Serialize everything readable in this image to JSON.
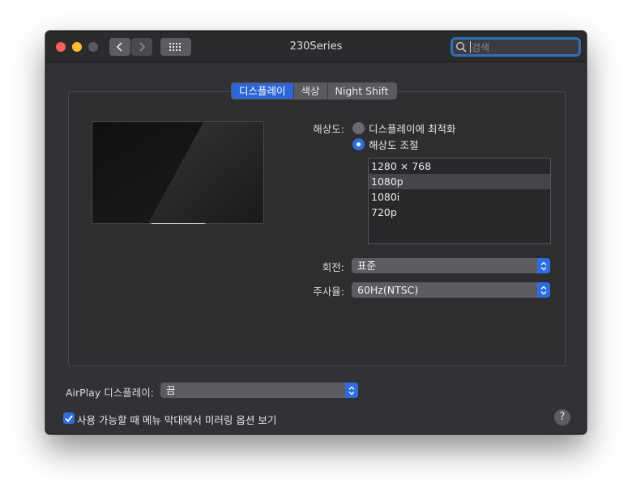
{
  "window": {
    "title": "230Series",
    "search_placeholder": "검색"
  },
  "tabs": [
    {
      "label": "디스플레이",
      "active": true
    },
    {
      "label": "색상",
      "active": false
    },
    {
      "label": "Night Shift",
      "active": false
    }
  ],
  "resolution": {
    "label": "해상도:",
    "options": [
      {
        "label": "디스플레이에 최적화",
        "selected": false
      },
      {
        "label": "해상도 조절",
        "selected": true
      }
    ],
    "list": [
      "1280 × 768",
      "1080p",
      "1080i",
      "720p"
    ],
    "selected_item": "1080p"
  },
  "rotation": {
    "label": "회전:",
    "value": "표준"
  },
  "refresh_rate": {
    "label": "주사율:",
    "value": "60Hz(NTSC)"
  },
  "airplay": {
    "label": "AirPlay 디스플레이:",
    "value": "끔"
  },
  "mirroring_option": {
    "label": "사용 가능할 때 메뉴 막대에서 미러링 옵션 보기",
    "checked": true
  },
  "help": {
    "label": "?"
  },
  "colors": {
    "accent": "#2d6de0",
    "window_bg": "#323236",
    "close": "#ff5f57",
    "minimize": "#febc2e"
  }
}
